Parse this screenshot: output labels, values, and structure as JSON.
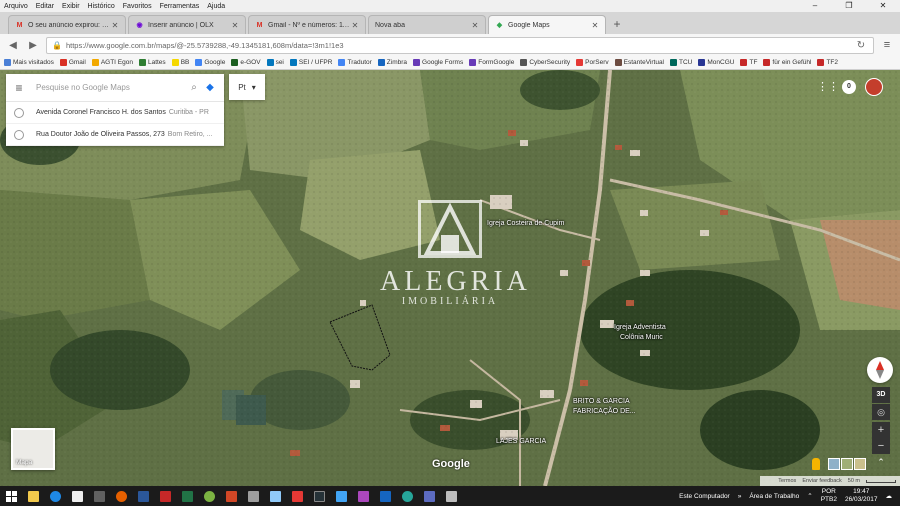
{
  "menu": [
    "Arquivo",
    "Editar",
    "Exibir",
    "Histórico",
    "Favoritos",
    "Ferramentas",
    "Ajuda"
  ],
  "window_controls": {
    "minimize": "–",
    "restore": "❐",
    "close": "✕"
  },
  "tabs": [
    {
      "label": "O seu anúncio expirou: Te...",
      "icon": "gmail-icon",
      "active": false
    },
    {
      "label": "Inserir anúncio | OLX",
      "icon": "olx-icon",
      "active": false
    },
    {
      "label": "Gmail - Nº e números: 118...",
      "icon": "gmail-icon",
      "active": false
    },
    {
      "label": "Nova aba",
      "icon": "none",
      "active": false
    },
    {
      "label": "Google Maps",
      "icon": "maps-icon",
      "active": true
    }
  ],
  "new_tab": "+",
  "address_bar": {
    "url": "https://www.google.com.br/maps/@-25.5739288,-49.1345181,608m/data=!3m1!1e3"
  },
  "bookmarks": [
    {
      "label": "Mais visitados",
      "color": "#4a7fd6"
    },
    {
      "label": "Gmail",
      "color": "#d93025"
    },
    {
      "label": "AGTI Egon",
      "color": "#f2a900"
    },
    {
      "label": "Lattes",
      "color": "#2e7d32"
    },
    {
      "label": "BB",
      "color": "#f5d800"
    },
    {
      "label": "Google",
      "color": "#4285f4"
    },
    {
      "label": "e-GOV",
      "color": "#1b5e20"
    },
    {
      "label": "sei",
      "color": "#0277bd"
    },
    {
      "label": "SEI / UFPR",
      "color": "#0277bd"
    },
    {
      "label": "Tradutor",
      "color": "#4285f4"
    },
    {
      "label": "Zimbra",
      "color": "#1565c0"
    },
    {
      "label": "Google Forms",
      "color": "#673ab7"
    },
    {
      "label": "FormGoogle",
      "color": "#673ab7"
    },
    {
      "label": "CyberSecurity",
      "color": "#555555"
    },
    {
      "label": "PorServ",
      "color": "#e53935"
    },
    {
      "label": "EstanteVirtual",
      "color": "#6d4c41"
    },
    {
      "label": "TCU",
      "color": "#00695c"
    },
    {
      "label": "MonCGU",
      "color": "#283593"
    },
    {
      "label": "TF",
      "color": "#c62828"
    },
    {
      "label": "für ein Gefühl",
      "color": "#c62828"
    },
    {
      "label": "TF2",
      "color": "#c62828"
    }
  ],
  "search": {
    "placeholder": "Pesquise no Google Maps",
    "suggestions": [
      {
        "main": "Avenida Coronel Francisco H. dos Santos",
        "sub": "Curitiba - PR"
      },
      {
        "main": "Rua Doutor João de Oliveira Passos, 273",
        "sub": "Bom Retiro, ..."
      }
    ]
  },
  "layer_box": {
    "label": "Pt",
    "caret": "▾"
  },
  "watermark": {
    "brand": "ALEGRIA",
    "sub": "IMOBILIÁRIA"
  },
  "map_labels": [
    {
      "text": "Igreja Costeira de Cupim"
    },
    {
      "text": "Igreja Adventista"
    },
    {
      "text": "Colônia Muric"
    },
    {
      "text": "BRITO & GARCIA"
    },
    {
      "text": "FABRICAÇÃO DE..."
    },
    {
      "text": "LAJES GARCIA"
    }
  ],
  "google_logo": "Google",
  "map_type_label": "Mapa",
  "controls": {
    "three_d": "3D",
    "zoom_in": "+",
    "zoom_out": "−",
    "expand": "⌃"
  },
  "notifications_count": "0",
  "footer": {
    "terms": "Termos",
    "feedback": "Enviar feedback",
    "scale": "50 m"
  },
  "taskbar": {
    "this_pc": "Este Computador",
    "desktop": "Área de Trabalho",
    "lang": "POR",
    "lang_sub": "PTB2",
    "time": "19:47",
    "date": "26/03/2017"
  }
}
